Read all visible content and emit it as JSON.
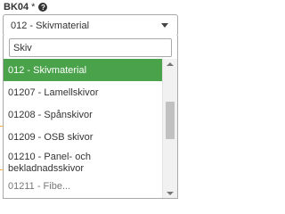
{
  "field": {
    "label": "BK04",
    "required_mark": "*",
    "help_icon": "question-circle-icon",
    "selected_value": "012 - Skivmaterial"
  },
  "dropdown": {
    "search_value": "Skiv",
    "options": [
      {
        "label": "012 - Skivmaterial",
        "highlighted": true
      },
      {
        "label": "01207 - Lamellskivor",
        "highlighted": false
      },
      {
        "label": "01208 - Spånskivor",
        "highlighted": false
      },
      {
        "label": "01209 - OSB skivor",
        "highlighted": false
      },
      {
        "label": "01210 - Panel- och bekladnadsskivor",
        "highlighted": false
      },
      {
        "label": "01211 - Fibe...",
        "highlighted": false
      }
    ]
  },
  "colors": {
    "highlight": "#4aa24a",
    "accent_line": "#f0ad4e"
  }
}
